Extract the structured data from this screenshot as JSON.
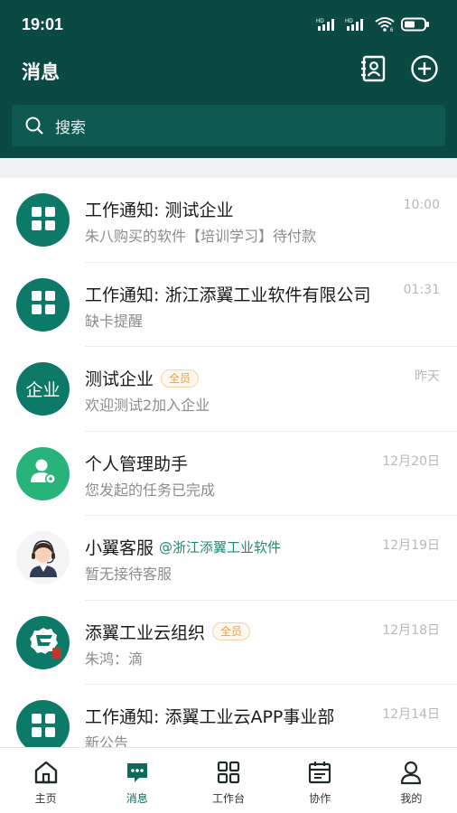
{
  "status_bar": {
    "time": "19:01",
    "signal_1": "HD",
    "signal_2": "HD",
    "wifi_badge": "6"
  },
  "header": {
    "title": "消息",
    "search_placeholder": "搜索"
  },
  "colors": {
    "brand": "#0b4a42",
    "accent": "#0d7a68",
    "badge": "#e8a040"
  },
  "conversations": [
    {
      "title": "工作通知: 测试企业",
      "subtitle": "朱八购买的软件【培训学习】待付款",
      "time": "10:00",
      "avatar_icon": "grid-icon"
    },
    {
      "title": "工作通知: 浙江添翼工业软件有限公司",
      "subtitle": "缺卡提醒",
      "time": "01:31",
      "avatar_icon": "grid-icon"
    },
    {
      "title": "测试企业",
      "badge": "全员",
      "subtitle": "欢迎测试2加入企业",
      "time": "昨天",
      "avatar_text": "企业"
    },
    {
      "title": "个人管理助手",
      "subtitle": "您发起的任务已完成",
      "time": "12月20日",
      "avatar_icon": "person-gear-icon"
    },
    {
      "title": "小翼客服",
      "mention": "@浙江添翼工业软件",
      "subtitle": "暂无接待客服",
      "time": "12月19日",
      "avatar_icon": "customer-service-icon"
    },
    {
      "title": "添翼工业云组织",
      "badge": "全员",
      "subtitle": "朱鸿：滴",
      "time": "12月18日",
      "avatar_icon": "org-logo-icon"
    },
    {
      "title": "工作通知: 添翼工业云APP事业部",
      "subtitle": "新公告",
      "time": "12月14日",
      "avatar_icon": "grid-icon"
    }
  ],
  "tabbar": [
    {
      "label": "主页",
      "icon": "home-icon"
    },
    {
      "label": "消息",
      "icon": "message-icon",
      "active": true
    },
    {
      "label": "工作台",
      "icon": "apps-icon"
    },
    {
      "label": "协作",
      "icon": "calendar-icon"
    },
    {
      "label": "我的",
      "icon": "profile-icon"
    }
  ]
}
